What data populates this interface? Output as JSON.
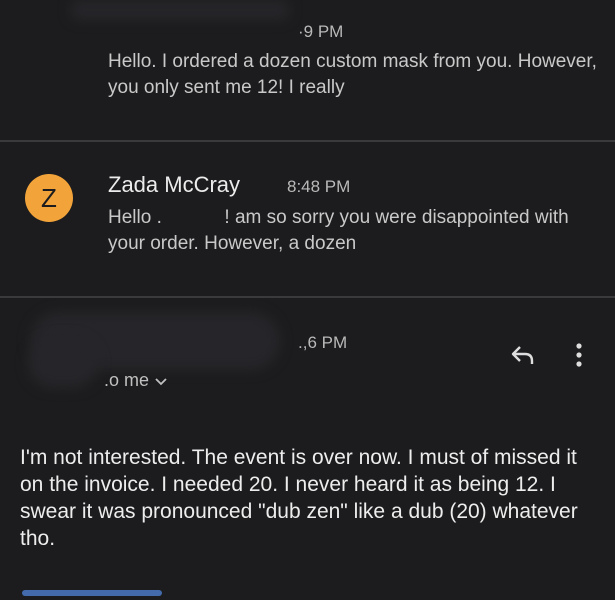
{
  "message1": {
    "time": "·9 PM",
    "snippet": "Hello. I ordered a dozen custom mask from you. However, you only sent me 12! I really"
  },
  "message2": {
    "avatar_letter": "Z",
    "sender": "Zada McCray",
    "time": "8:48 PM",
    "snippet_part1": "Hello .",
    "snippet_part2": "! am so sorry you were disappointed with your order. However, a dozen"
  },
  "message3": {
    "time": ".,6 PM",
    "to_me": ".o me",
    "body": "I'm not interested. The event is over now. I must of missed it on the invoice. I needed 20. I never heard it as being 12. I swear it was pronounced \"dub zen\" like a dub (20) whatever tho."
  },
  "icons": {
    "reply": "reply-icon",
    "more": "more-vert-icon",
    "chevron": "chevron-down-icon"
  },
  "colors": {
    "background": "#1c1c1e",
    "avatar": "#f2a43a",
    "link": "#4e7fd0"
  }
}
